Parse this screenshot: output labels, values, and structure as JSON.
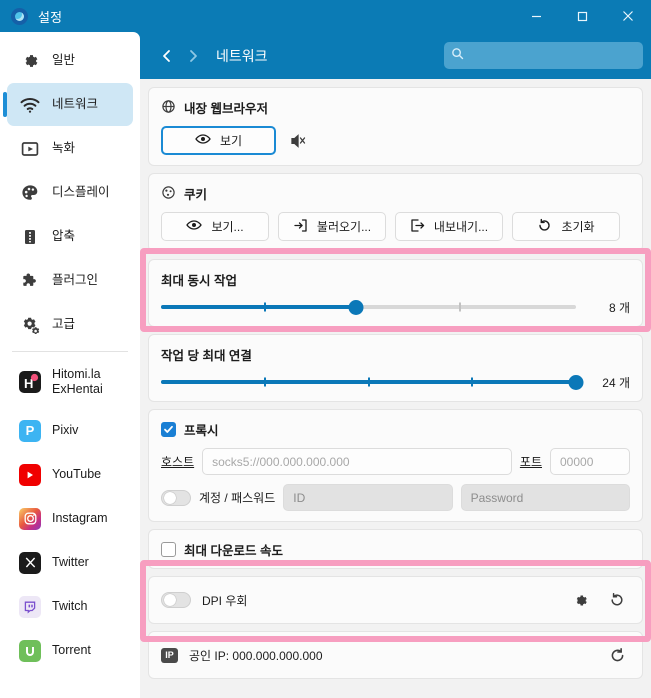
{
  "window": {
    "title": "설정",
    "logo_icon": "app-logo-icon",
    "controls": {
      "minimize": "minimize-icon",
      "maximize": "maximize-icon",
      "close": "close-icon"
    }
  },
  "sidebar": {
    "items": [
      {
        "label": "일반",
        "icon": "gear-icon",
        "active": false
      },
      {
        "label": "네트워크",
        "icon": "wifi-icon",
        "active": true
      },
      {
        "label": "녹화",
        "icon": "video-icon",
        "active": false
      },
      {
        "label": "디스플레이",
        "icon": "palette-icon",
        "active": false
      },
      {
        "label": "압축",
        "icon": "archive-icon",
        "active": false
      },
      {
        "label": "플러그인",
        "icon": "puzzle-icon",
        "active": false
      },
      {
        "label": "고급",
        "icon": "gears-icon",
        "active": false
      }
    ],
    "brands": [
      {
        "label": "Hitomi.la ExHentai",
        "icon": "hitomi-icon"
      },
      {
        "label": "Pixiv",
        "icon": "pixiv-icon"
      },
      {
        "label": "YouTube",
        "icon": "youtube-icon"
      },
      {
        "label": "Instagram",
        "icon": "instagram-icon"
      },
      {
        "label": "Twitter",
        "icon": "twitter-x-icon"
      },
      {
        "label": "Twitch",
        "icon": "twitch-icon"
      },
      {
        "label": "Torrent",
        "icon": "torrent-icon"
      }
    ]
  },
  "toolbar": {
    "back_icon": "chevron-left-icon",
    "forward_icon": "chevron-right-icon",
    "breadcrumb": "네트워크",
    "search_icon": "search-icon",
    "search_value": "",
    "search_placeholder": ""
  },
  "sections": {
    "browser": {
      "title": "내장 웹브라우저",
      "title_icon": "globe-icon",
      "view_button": "보기",
      "view_button_icon": "eye-icon",
      "mute_icon": "speaker-mute-icon"
    },
    "cookie": {
      "title": "쿠키",
      "title_icon": "cookie-icon",
      "buttons": [
        {
          "label": "보기...",
          "icon": "eye-icon"
        },
        {
          "label": "불러오기...",
          "icon": "import-icon"
        },
        {
          "label": "내보내기...",
          "icon": "export-icon"
        },
        {
          "label": "초기화",
          "icon": "reset-icon"
        }
      ]
    },
    "max_jobs": {
      "title": "최대 동시 작업",
      "value": 8,
      "unit": "개",
      "min": 1,
      "max": 17,
      "percent": 47,
      "ticks_percent": [
        25,
        47,
        72,
        95
      ],
      "highlighted": true
    },
    "max_conn": {
      "title": "작업 당 최대 연결",
      "value": 24,
      "unit": "개",
      "min": 1,
      "max": 24,
      "percent": 100,
      "ticks_percent": [
        25,
        50,
        75
      ],
      "highlighted": false
    },
    "proxy": {
      "title": "프록시",
      "checked": true,
      "host_label": "호스트",
      "host_value": "",
      "host_placeholder": "socks5://000.000.000.000",
      "port_label": "포트",
      "port_value": "",
      "port_placeholder": "00000",
      "auth_toggle": false,
      "auth_label": "계정 / 패스워드",
      "id_value": "",
      "id_placeholder": "ID",
      "pw_value": "",
      "pw_placeholder": "Password"
    },
    "max_speed": {
      "title": "최대 다운로드 속도",
      "checked": false
    },
    "dpi": {
      "label": "DPI 우회",
      "toggle": false,
      "settings_icon": "gear-icon",
      "reset_icon": "reset-icon",
      "highlighted": true
    },
    "public_ip": {
      "badge": "IP",
      "text": "공인 IP: 000.000.000.000",
      "refresh_icon": "refresh-icon"
    }
  },
  "colors": {
    "accent": "#0b7bb5",
    "slider": "#0b78b8",
    "highlight": "#f79ec0",
    "sidebar_active": "#cfe7f5"
  }
}
